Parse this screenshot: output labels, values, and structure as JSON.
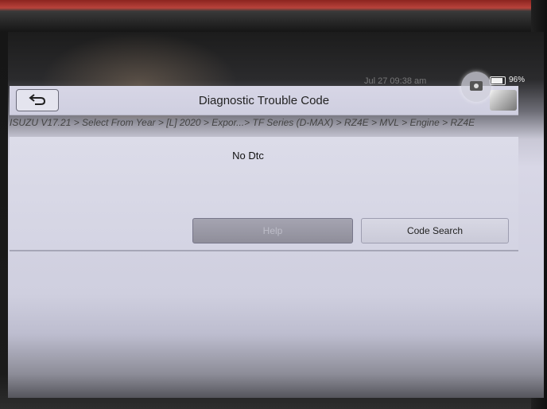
{
  "status": {
    "time": "Jul 27  09:38 am",
    "battery": "96%"
  },
  "header": {
    "title": "Diagnostic Trouble Code"
  },
  "breadcrumb": "ISUZU V17.21 > Select From Year > [L] 2020 > Expor...> TF Series (D-MAX) > RZ4E > MVL > Engine > RZ4E",
  "main": {
    "message": "No Dtc"
  },
  "buttons": {
    "help": "Help",
    "code_search": "Code Search"
  },
  "icons": {
    "back": "back-arrow-icon",
    "camera": "camera-icon",
    "battery": "battery-icon",
    "menu": "menu-icon"
  }
}
